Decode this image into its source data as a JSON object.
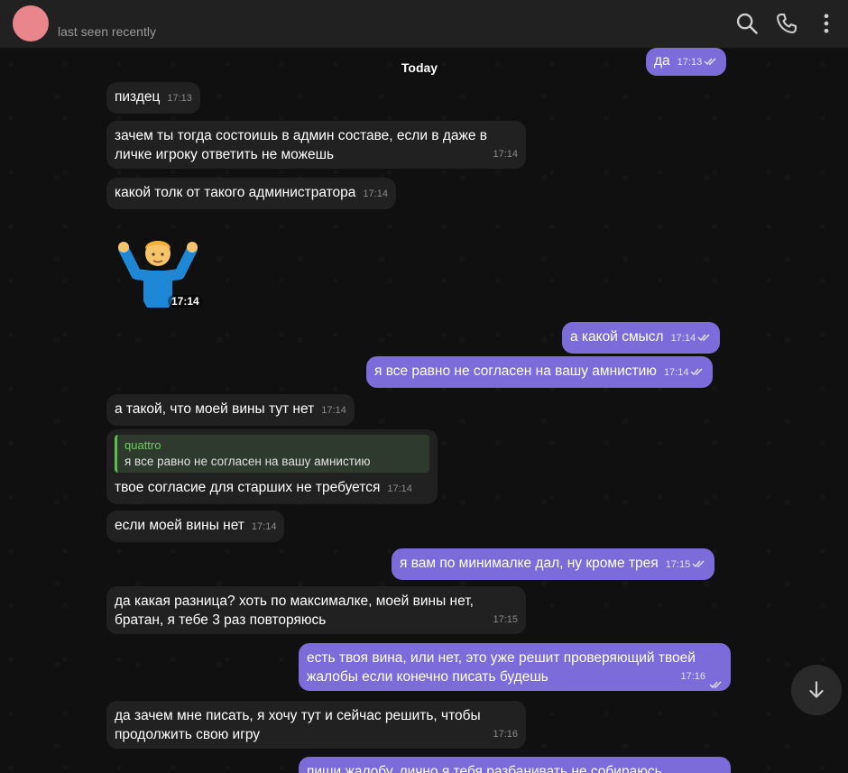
{
  "header": {
    "status": "last seen recently",
    "avatar_color": "#e8868c"
  },
  "chat": {
    "date_separator": "Today",
    "messages": [
      {
        "dir": "out",
        "text": "да",
        "time": "17:13"
      },
      {
        "dir": "in",
        "text": "пиздец",
        "time": "17:13"
      },
      {
        "dir": "in",
        "text": "зачем ты тогда состоишь в админ составе, если в даже в личке игроку ответить не можешь",
        "time": "17:14"
      },
      {
        "dir": "in",
        "text": "какой толк от такого администратора",
        "time": "17:14"
      },
      {
        "dir": "in",
        "sticker": "shrug-emoji",
        "time": "17:14"
      },
      {
        "dir": "out",
        "text": "а какой смысл",
        "time": "17:14"
      },
      {
        "dir": "out",
        "text": "я все равно не согласен на вашу амнистию",
        "time": "17:14"
      },
      {
        "dir": "in",
        "text": "а такой, что моей вины тут нет",
        "time": "17:14"
      },
      {
        "dir": "in",
        "reply_name": "quattro",
        "reply_text": "я все равно не согласен на вашу амнистию",
        "text": "твое согласие для старших не требуется",
        "time": "17:14"
      },
      {
        "dir": "in",
        "text": "если моей вины нет",
        "time": "17:14"
      },
      {
        "dir": "out",
        "text": "я вам по минималке дал, ну кроме трея",
        "time": "17:15"
      },
      {
        "dir": "in",
        "text": "да какая разница? хоть по максималке, моей вины нет, братан, я тебе 3 раз повторяюсь",
        "time": "17:15"
      },
      {
        "dir": "out",
        "text": "есть твоя вина, или нет, это уже решит проверяющий твоей жалобы  если конечно писать будешь",
        "time": "17:16"
      },
      {
        "dir": "in",
        "text": "да зачем мне писать, я хочу тут и сейчас решить, чтобы продолжить свою игру",
        "time": "17:16"
      },
      {
        "dir": "out",
        "text": "пиши жалобу, лично я тебя разбанивать не собираюсь",
        "time": ""
      }
    ]
  },
  "colors": {
    "incoming_bubble": "#212121",
    "outgoing_bubble": "#7b6cd9",
    "reply_accent": "#5fbf4c"
  },
  "icons": [
    "search-icon",
    "phone-icon",
    "more-vertical-icon",
    "arrow-down-icon",
    "double-check-icon"
  ]
}
